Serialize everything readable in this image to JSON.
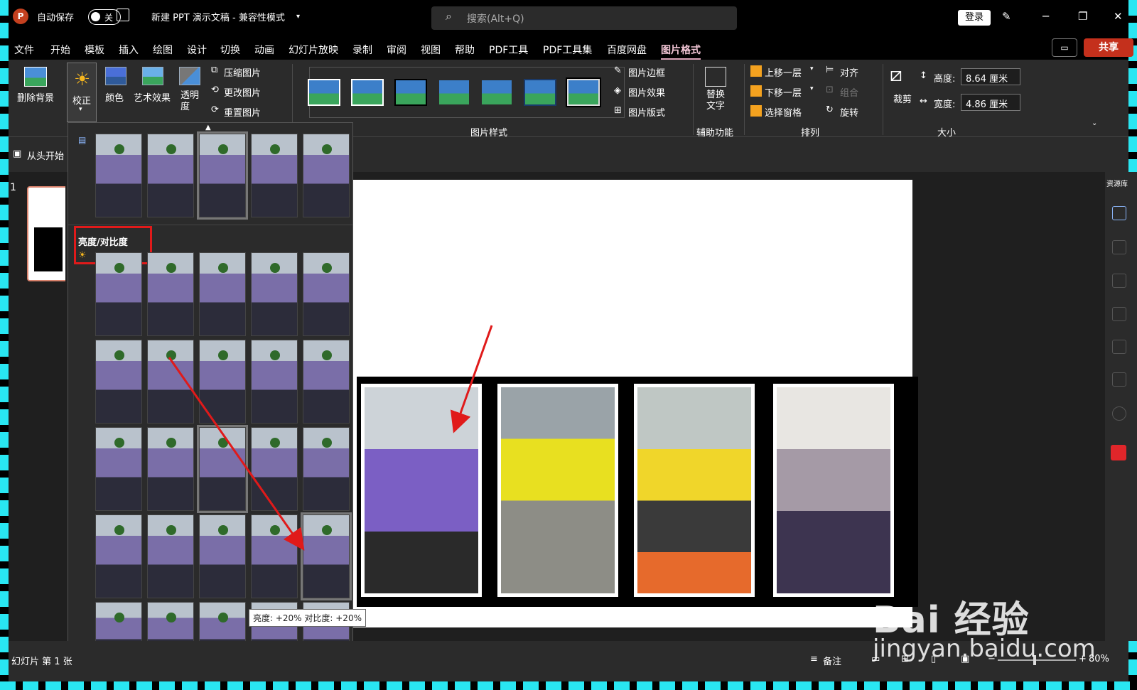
{
  "titlebar": {
    "autosave_label": "自动保存",
    "autosave_state": "关",
    "doc_title": "新建 PPT 演示文稿  -  兼容性模式",
    "search_placeholder": "搜索(Alt+Q)",
    "login": "登录"
  },
  "menu": {
    "items": [
      "文件",
      "开始",
      "模板",
      "插入",
      "绘图",
      "设计",
      "切换",
      "动画",
      "幻灯片放映",
      "录制",
      "审阅",
      "视图",
      "帮助",
      "PDF工具",
      "PDF工具集",
      "百度网盘",
      "图片格式"
    ],
    "active": "图片格式",
    "share": "共享"
  },
  "ribbon": {
    "remove_bg": "删除背景",
    "correct": "校正",
    "color": "颜色",
    "art_effects": "艺术效果",
    "transparency": "透明\n度",
    "compress": "压缩图片",
    "change": "更改图片",
    "reset": "重置图片",
    "picture_styles_group": "图片样式",
    "border": "图片边框",
    "effects": "图片效果",
    "layout": "图片版式",
    "alt_text": "替换\n文字",
    "accessibility_group": "辅助功能",
    "bring_forward": "上移一层",
    "send_backward": "下移一层",
    "selection_pane": "选择窗格",
    "align": "对齐",
    "group": "组合",
    "rotate": "旋转",
    "arrange_group": "排列",
    "crop": "裁剪",
    "height_label": "高度:",
    "height_value": "8.64 厘米",
    "width_label": "宽度:",
    "width_value": "4.86 厘米",
    "size_group": "大小"
  },
  "qstrip": {
    "from_start": "从头开始"
  },
  "slides_pane": {
    "slide_number": "1"
  },
  "gallery": {
    "section_title": "亮度/对比度",
    "tooltip": "亮度: +20% 对比度: +20%"
  },
  "sidepanel": {
    "title": "资源库"
  },
  "status": {
    "slide_info": "幻灯片 第 1 张",
    "notes": "备注",
    "zoom": "80%"
  },
  "watermark": {
    "brand": "Bai  经验",
    "url": "jingyan.baidu.com"
  },
  "colors": {
    "accent": "#d9a3b8",
    "share": "#c4301c",
    "highlight": "#e01a1a",
    "frame": "#29e6f2"
  }
}
